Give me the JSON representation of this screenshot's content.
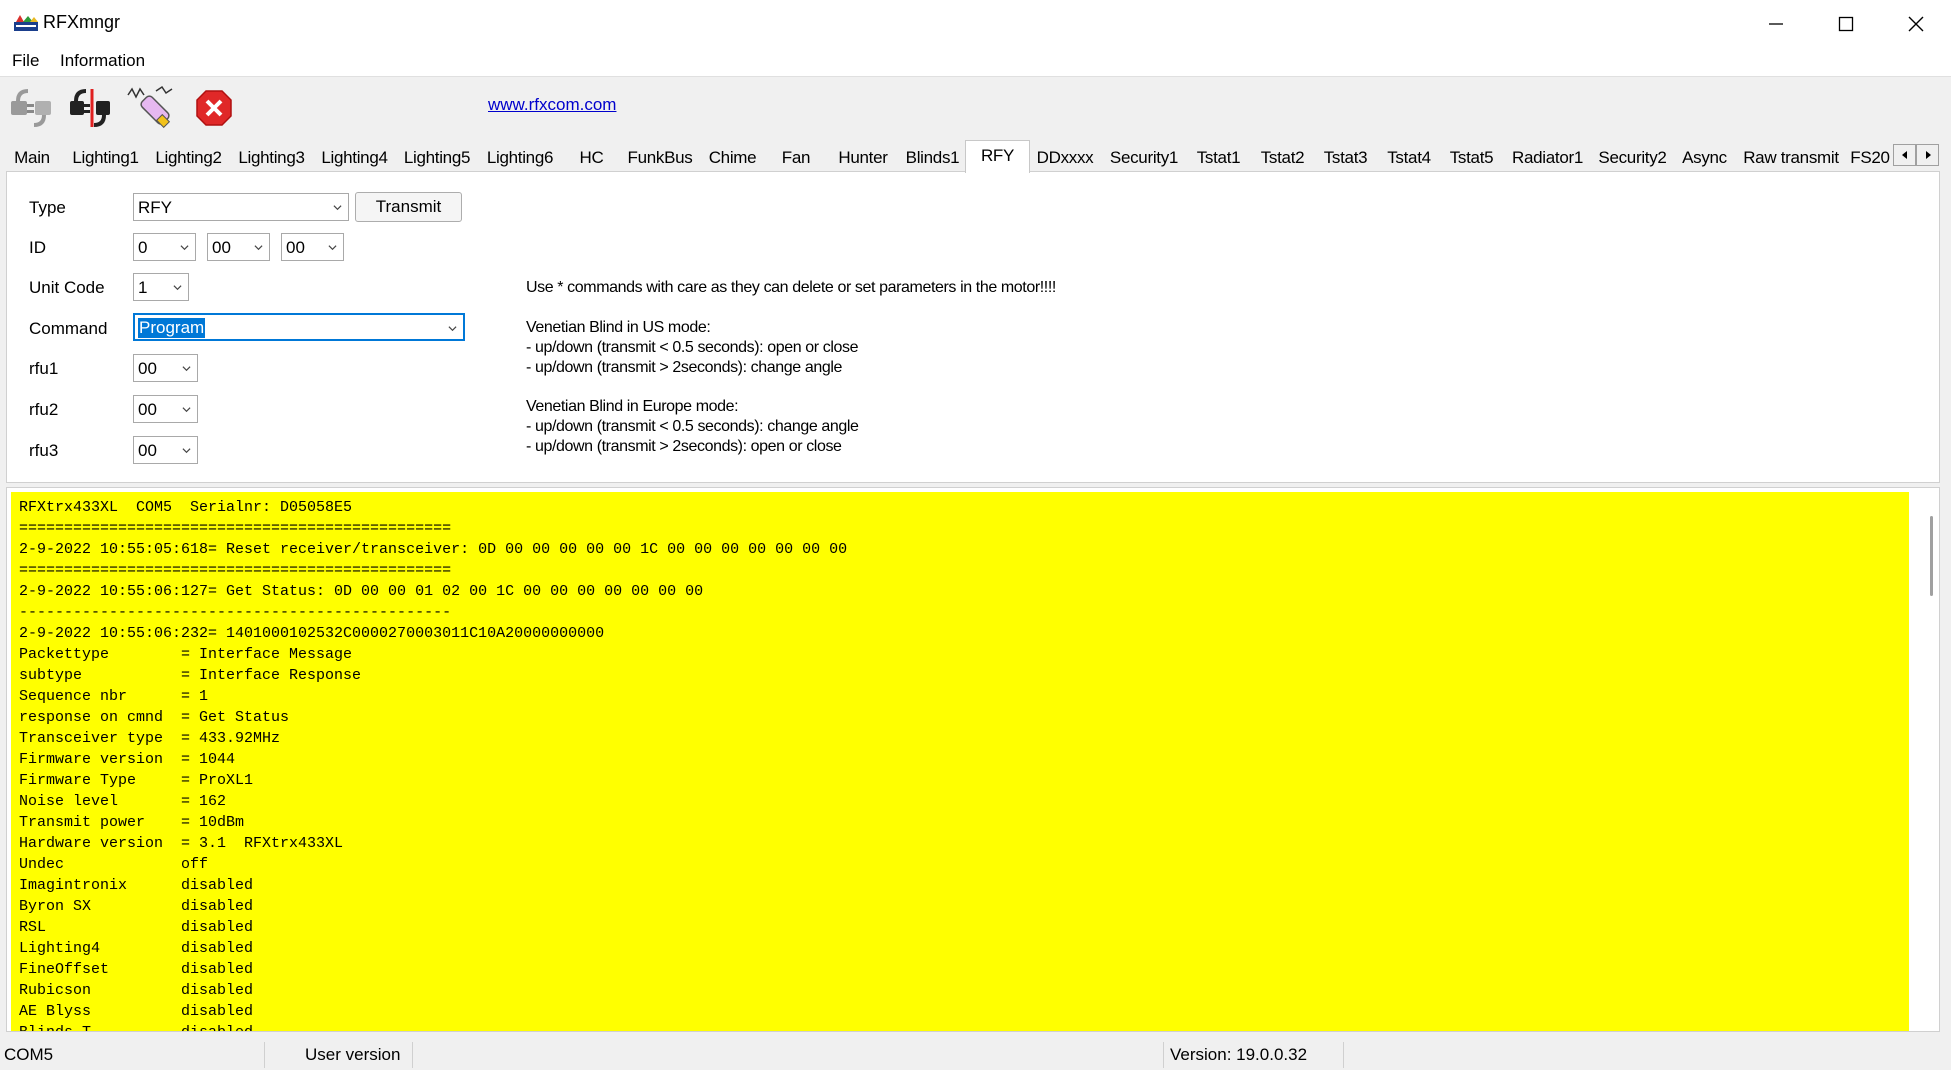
{
  "window": {
    "title": "RFXmngr",
    "icon": "rfxcom-logo-icon",
    "controls": [
      "minimize",
      "maximize",
      "close"
    ]
  },
  "menu": [
    "File",
    "Information"
  ],
  "toolbar": {
    "buttons": [
      {
        "icon": "connect-plug-icon",
        "enabled": false
      },
      {
        "icon": "disconnect-plug-icon",
        "enabled": true
      },
      {
        "icon": "transceiver-stick-icon",
        "enabled": true
      },
      {
        "icon": "stop-red-x-icon",
        "enabled": true
      }
    ],
    "link": "www.rfxcom.com"
  },
  "tabs": [
    "Main",
    "Lighting1",
    "Lighting2",
    "Lighting3",
    "Lighting4",
    "Lighting5",
    "Lighting6",
    "HC",
    "FunkBus",
    "Chime",
    "Fan",
    "Hunter",
    "Blinds1",
    "RFY",
    "DDxxxx",
    "Security1",
    "Tstat1",
    "Tstat2",
    "Tstat3",
    "Tstat4",
    "Tstat5",
    "Radiator1",
    "Security2",
    "Async",
    "Raw transmit",
    "FS20"
  ],
  "active_tab": "RFY",
  "form": {
    "type_label": "Type",
    "type_value": "RFY",
    "transmit_label": "Transmit",
    "id_label": "ID",
    "id1": "0",
    "id2": "00",
    "id3": "00",
    "unit_label": "Unit Code",
    "unit_value": "1",
    "command_label": "Command",
    "command_value": "Program",
    "rfu1_label": "rfu1",
    "rfu1_value": "00",
    "rfu2_label": "rfu2",
    "rfu2_value": "00",
    "rfu3_label": "rfu3",
    "rfu3_value": "00"
  },
  "notes": {
    "warning": "Use * commands with care as they can delete or set parameters in the motor!!!!",
    "us_mode": "Venetian Blind in US mode:\n- up/down (transmit < 0.5 seconds): open or close\n- up/down (transmit > 2seconds): change angle",
    "eu_mode": "Venetian Blind in Europe mode:\n- up/down (transmit < 0.5 seconds): change angle\n- up/down (transmit > 2seconds): open or close"
  },
  "log_text": "RFXtrx433XL  COM5  Serialnr: D05058E5\n================================================\n2-9-2022 10:55:05:618= Reset receiver/transceiver: 0D 00 00 00 00 00 1C 00 00 00 00 00 00 00\n================================================\n2-9-2022 10:55:06:127= Get Status: 0D 00 00 01 02 00 1C 00 00 00 00 00 00 00\n------------------------------------------------\n2-9-2022 10:55:06:232= 1401000102532C0000270003011C10A20000000000\nPackettype        = Interface Message\nsubtype           = Interface Response\nSequence nbr      = 1\nresponse on cmnd  = Get Status\nTransceiver type  = 433.92MHz\nFirmware version  = 1044\nFirmware Type     = ProXL1\nNoise level       = 162\nTransmit power    = 10dBm\nHardware version  = 3.1  RFXtrx433XL\nUndec             off\nImagintronix      disabled\nByron SX          disabled\nRSL               disabled\nLighting4         disabled\nFineOffset        disabled\nRubicson          disabled\nAE Blyss          disabled\nBlinds T...       disabled",
  "status": {
    "port": "COM5",
    "user": "User version",
    "version": "Version: 19.0.0.32"
  },
  "colors": {
    "log_background": "#ffff00",
    "link": "#0000cc",
    "selection": "#0078d7"
  }
}
